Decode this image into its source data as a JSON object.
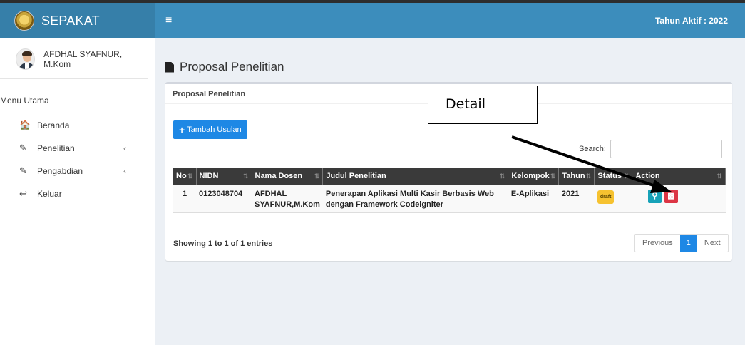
{
  "brand": {
    "name": "SEPAKAT"
  },
  "navbar": {
    "toggle_icon": "hamburger-icon",
    "year_text": "Tahun Aktif : 2022"
  },
  "sidebar": {
    "user_name": "AFDHAL SYAFNUR, M.Kom",
    "menu_header": "Menu Utama",
    "items": [
      {
        "label": "Beranda",
        "icon": "home-icon",
        "glyph": "🏠",
        "has_children": false
      },
      {
        "label": "Penelitian",
        "icon": "edit-icon",
        "glyph": "✎",
        "has_children": true
      },
      {
        "label": "Pengabdian",
        "icon": "edit-icon",
        "glyph": "✎",
        "has_children": true
      },
      {
        "label": "Keluar",
        "icon": "reply-icon",
        "glyph": "↩",
        "has_children": false
      }
    ],
    "chevron": "‹"
  },
  "page": {
    "title": "Proposal Penelitian"
  },
  "box": {
    "title": "Proposal Penelitian",
    "add_button_label": "Tambah Usulan",
    "search_label": "Search:",
    "search_value": "",
    "table": {
      "headers": [
        "No",
        "NIDN",
        "Nama Dosen",
        "Judul Penelitian",
        "Kelompok",
        "Tahun",
        "Status",
        "Action"
      ],
      "rows": [
        {
          "no": "1",
          "nidn": "0123048704",
          "nama_line1": "AFDHAL",
          "nama_line2": "SYAFNUR,M.Kom",
          "judul_line1": "Penerapan Aplikasi Multi Kasir Berbasis Web",
          "judul_line2": "dengan Framework Codeigniter",
          "kelompok": "E-Aplikasi",
          "tahun": "2021",
          "status": "draft"
        }
      ]
    },
    "entries_text": "Showing 1 to 1 of 1 entries",
    "pagination": {
      "previous": "Previous",
      "current": "1",
      "next": "Next"
    }
  },
  "annotation": {
    "callout_text": "Detail"
  },
  "colors": {
    "navbar": "#3c8dbc",
    "brand": "#367fa9",
    "primary": "#1e88e5",
    "info": "#17a2b8",
    "danger": "#dc3545",
    "warning": "#f6c230"
  }
}
